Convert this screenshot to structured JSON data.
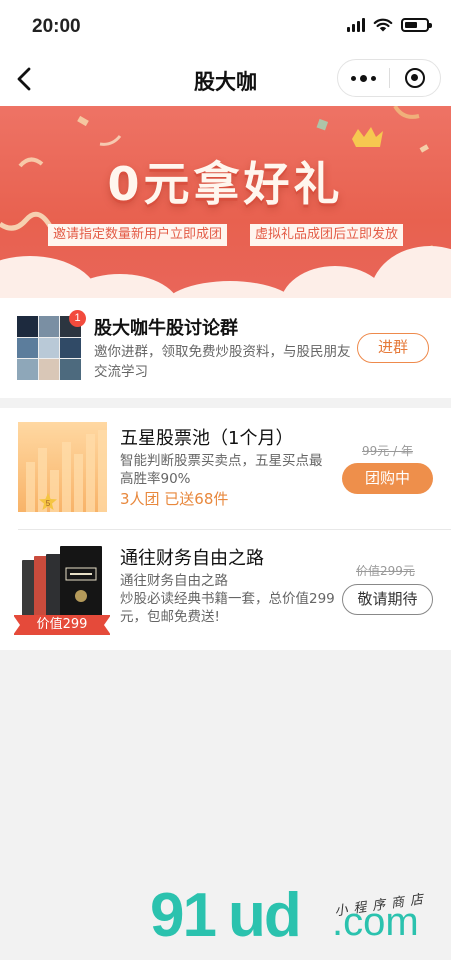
{
  "status_bar": {
    "time": "20:00"
  },
  "nav": {
    "title": "股大咖"
  },
  "banner": {
    "title": "0元拿好礼",
    "tag_left": "邀请指定数量新用户立即成团",
    "tag_right": "虚拟礼品成团后立即发放"
  },
  "group": {
    "title": "股大咖牛股讨论群",
    "description": "邀你进群，领取免费炒股资料，与股民朋友交流学习",
    "badge": "1",
    "join_label": "进群"
  },
  "products": [
    {
      "title": "五星股票池（1个月）",
      "description": "智能判断股票买卖点，五星买点最高胜率90%",
      "sales": "3人团 已送68件",
      "old_price": "99元 / 年",
      "button_label": "团购中",
      "thumb_badge": "5"
    },
    {
      "title": "通往财务自由之路",
      "description": "通往财务自由之路\n炒股必读经典书籍一套，总价值299元，包邮免费送!",
      "old_price": "价值299元",
      "button_label": "敬请期待",
      "thumb_tag": "价值299"
    }
  ],
  "watermark": {
    "brand_a": "91",
    "brand_b": "ud",
    "brand_c": ".com",
    "store": "小程序商店"
  },
  "colors": {
    "banner": "#e8614f",
    "accent_orange": "#ee8f4b",
    "watermark": "#2bc2ae"
  }
}
